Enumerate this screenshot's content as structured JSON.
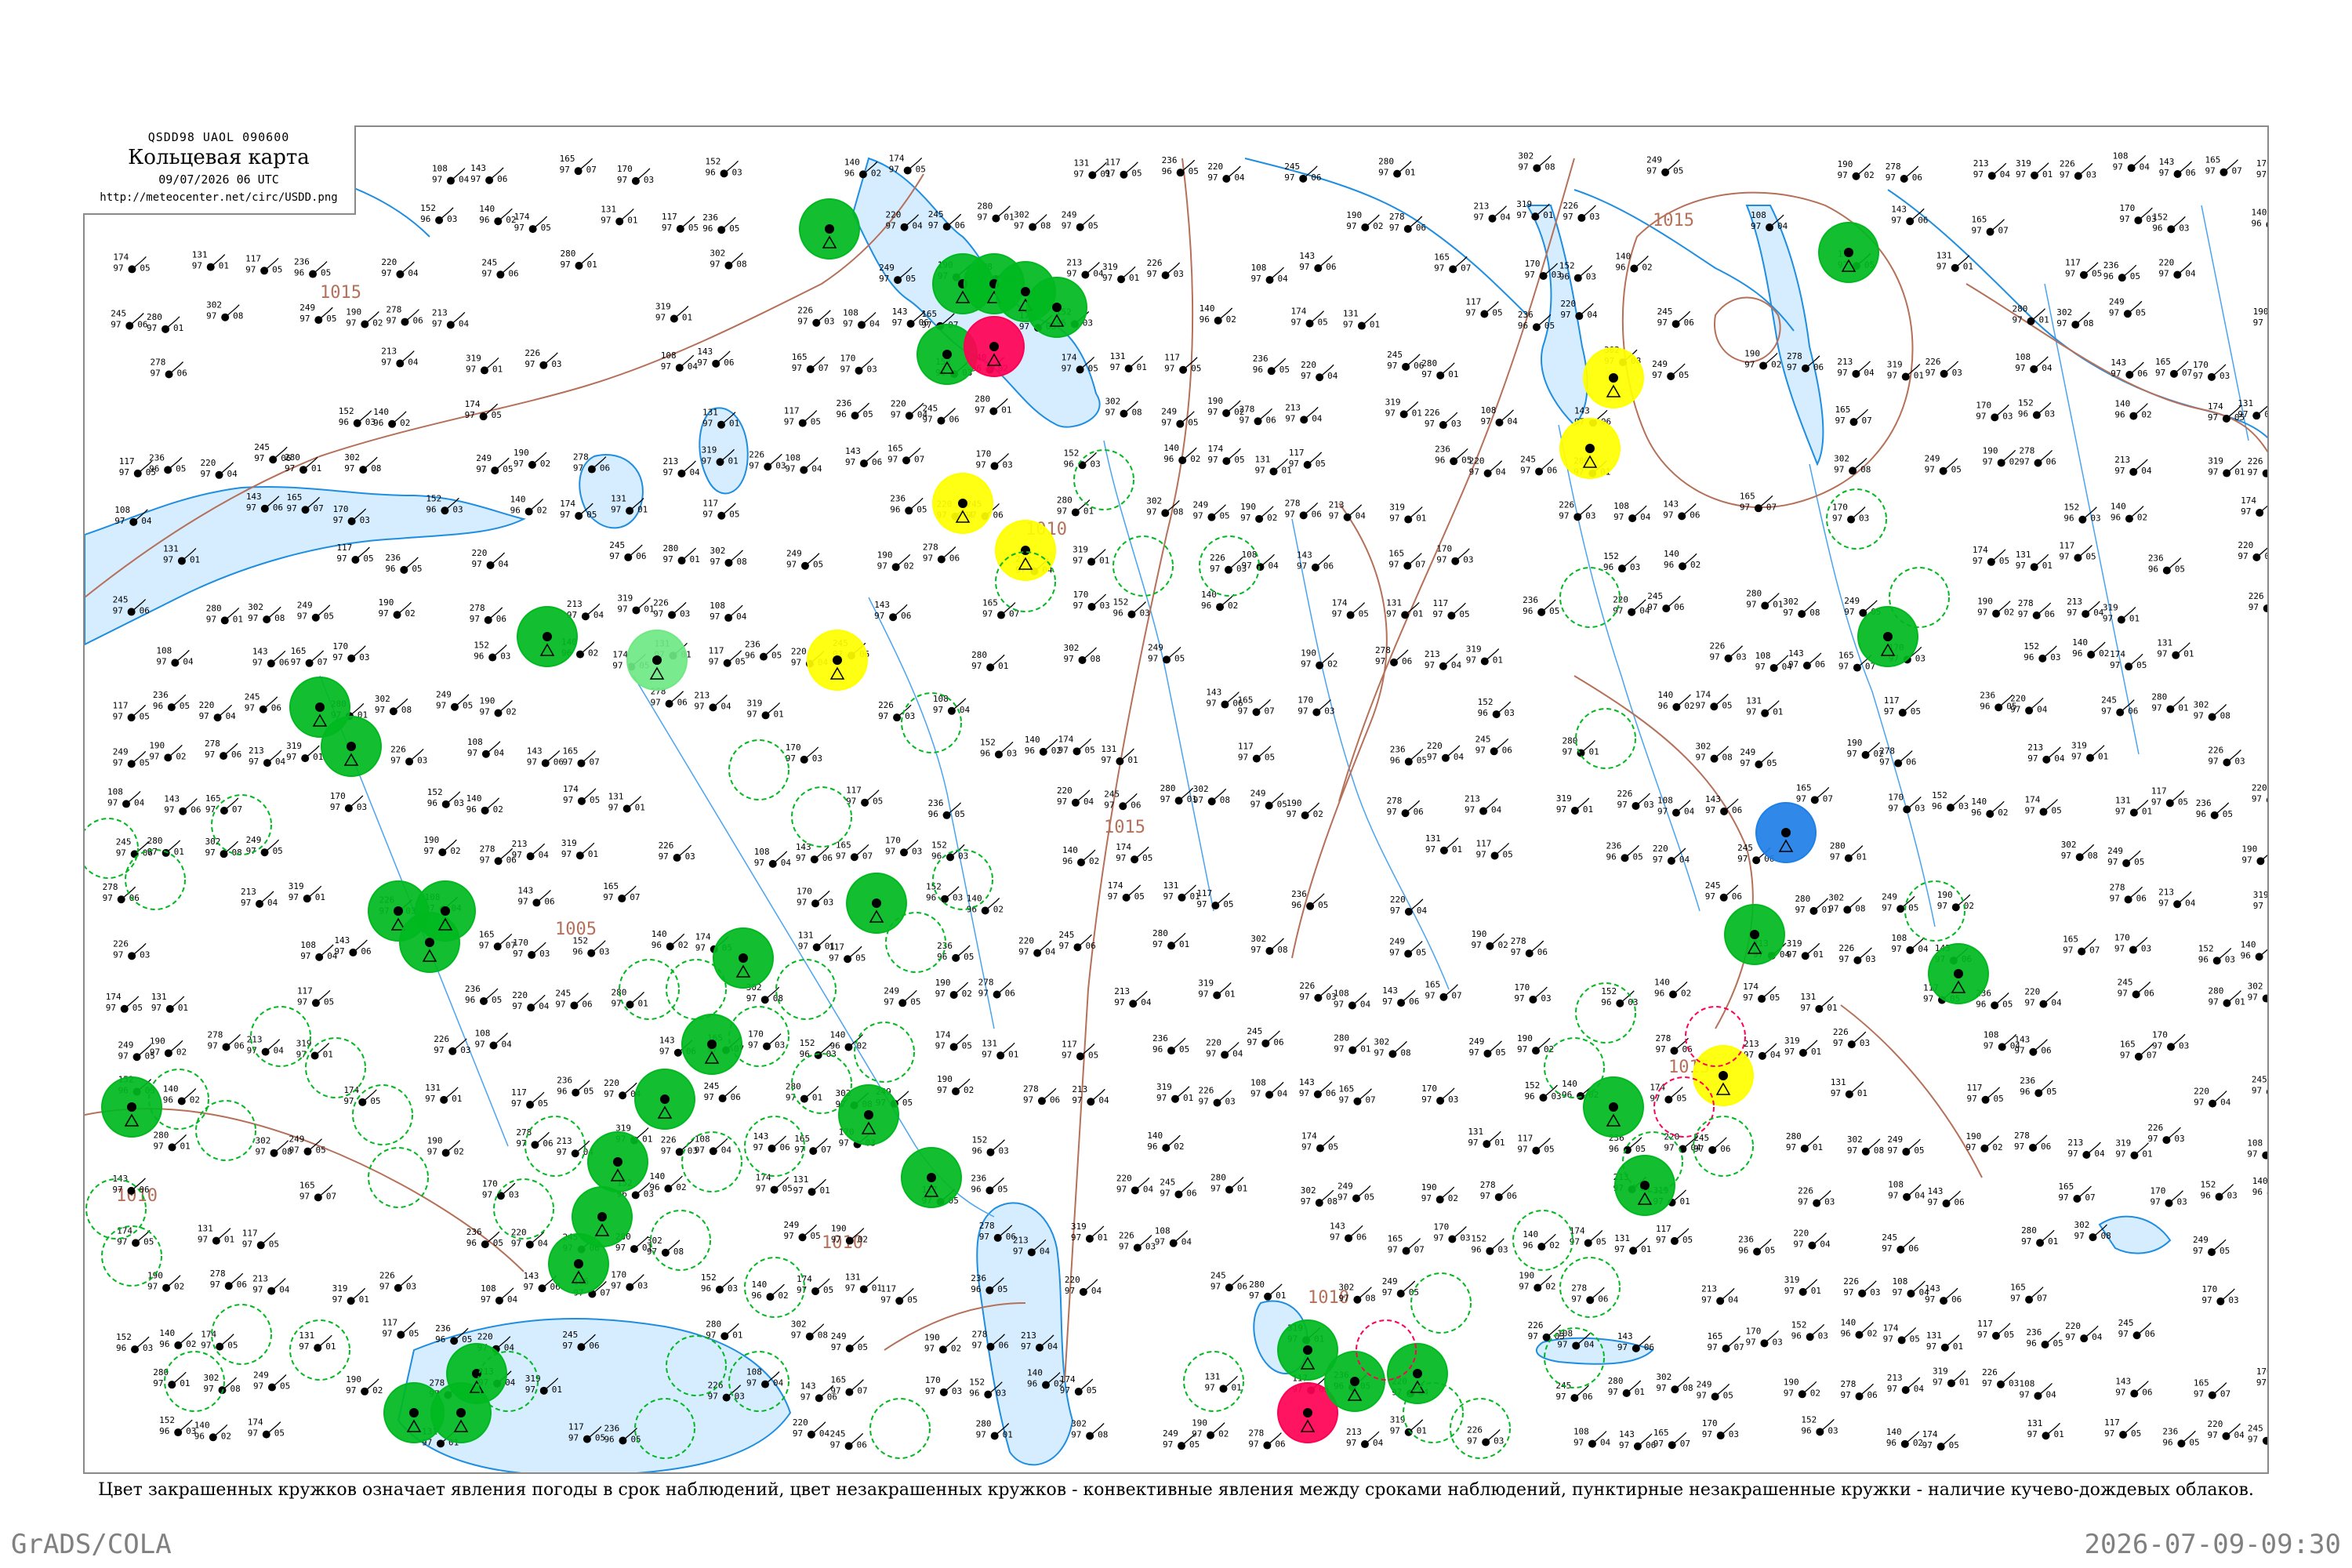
{
  "header": {
    "code": "QSDD98  UAOL  090600",
    "title": "Кольцевая карта",
    "datetime": "09/07/2026 06 UTC",
    "url": "http://meteocenter.net/circ/USDD.png"
  },
  "caption": "Цвет закрашенных кружков означает явления погоды в срок наблюдений, цвет незакрашенных кружков - конвективные явления между сроками наблюдений, пунктирные незакрашенные кружки - наличие кучево-дождевых облаков.",
  "footer": {
    "left": "GrADS/COLA",
    "right": "2026-07-09-09:30"
  },
  "isobars": [
    {
      "label": "1015"
    },
    {
      "label": "1015"
    },
    {
      "label": "1015"
    },
    {
      "label": "1010"
    },
    {
      "label": "1015"
    },
    {
      "label": "1005"
    },
    {
      "label": "1010"
    },
    {
      "label": "1015"
    },
    {
      "label": "1010"
    },
    {
      "label": "1010"
    }
  ],
  "station_samples": [
    {
      "t": "108",
      "p": "97",
      "v": "04"
    },
    {
      "t": "143",
      "p": "97",
      "v": "06"
    },
    {
      "t": "165",
      "p": "97",
      "v": "07"
    },
    {
      "t": "170",
      "p": "97",
      "v": "03"
    },
    {
      "t": "152",
      "p": "96",
      "v": "03"
    },
    {
      "t": "140",
      "p": "96",
      "v": "02"
    },
    {
      "t": "174",
      "p": "97",
      "v": "05"
    },
    {
      "t": "131",
      "p": "97",
      "v": "01"
    },
    {
      "t": "117",
      "p": "97",
      "v": "05"
    },
    {
      "t": "236",
      "p": "96",
      "v": "05"
    },
    {
      "t": "220",
      "p": "97",
      "v": "04"
    },
    {
      "t": "245",
      "p": "97",
      "v": "06"
    },
    {
      "t": "280",
      "p": "97",
      "v": "01"
    },
    {
      "t": "302",
      "p": "97",
      "v": "08"
    },
    {
      "t": "249",
      "p": "97",
      "v": "05"
    },
    {
      "t": "190",
      "p": "97",
      "v": "02"
    },
    {
      "t": "278",
      "p": "97",
      "v": "06"
    },
    {
      "t": "213",
      "p": "97",
      "v": "04"
    },
    {
      "t": "319",
      "p": "97",
      "v": "01"
    },
    {
      "t": "226",
      "p": "97",
      "v": "03"
    }
  ],
  "colors": {
    "land": "#ffffff",
    "water": "#d6ecff",
    "coast": "#1f8ee0",
    "isobar": "#b5705a",
    "thunder": "#00b81f",
    "fog_or_haze": "#ffff00",
    "severe": "#ff0055",
    "precip_blue": "#1e7fe6",
    "light_green": "#6fe884"
  }
}
